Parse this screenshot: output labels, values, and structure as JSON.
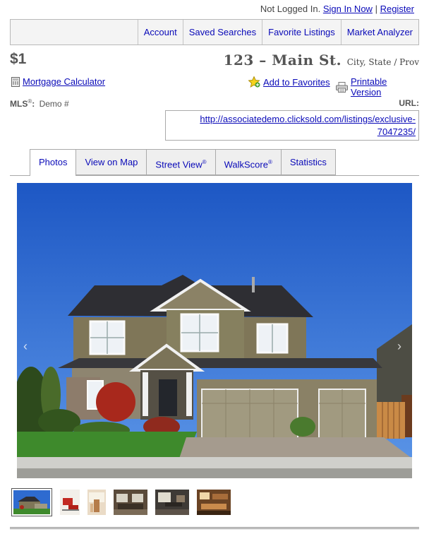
{
  "header": {
    "status_text": "Not Logged In.",
    "sign_in_label": "Sign In Now",
    "separator": "|",
    "register_label": "Register"
  },
  "nav": {
    "items": [
      {
        "label": "Account"
      },
      {
        "label": "Saved Searches"
      },
      {
        "label": "Favorite Listings"
      },
      {
        "label": "Market Analyzer"
      }
    ]
  },
  "listing": {
    "price": "$1",
    "street": "123 – Main St.",
    "city": "City, State / Prov",
    "mortgage_label": "Mortgage Calculator",
    "favorites_label": "Add to Favorites",
    "printable_label": "Printable Version",
    "mls_label": "MLS",
    "mls_reg": "®",
    "mls_colon": ":",
    "mls_value": "Demo #",
    "url_label": "URL:",
    "url_value": "http://associatedemo.clicksold.com/listings/exclusive-7047235/"
  },
  "tabs": [
    {
      "label": "Photos",
      "reg": "",
      "active": true
    },
    {
      "label": "View on Map",
      "reg": ""
    },
    {
      "label": "Street View",
      "reg": "®"
    },
    {
      "label": "WalkScore",
      "reg": "®"
    },
    {
      "label": "Statistics",
      "reg": ""
    }
  ],
  "gallery": {
    "prev_icon": "chevron-left-icon",
    "next_icon": "chevron-right-icon",
    "prev_glyph": "‹",
    "next_glyph": "›",
    "thumbnails": [
      {
        "name": "house-exterior",
        "active": true
      },
      {
        "name": "red-sofa"
      },
      {
        "name": "stairway"
      },
      {
        "name": "living-room"
      },
      {
        "name": "dining-area"
      },
      {
        "name": "kitchen"
      }
    ]
  }
}
